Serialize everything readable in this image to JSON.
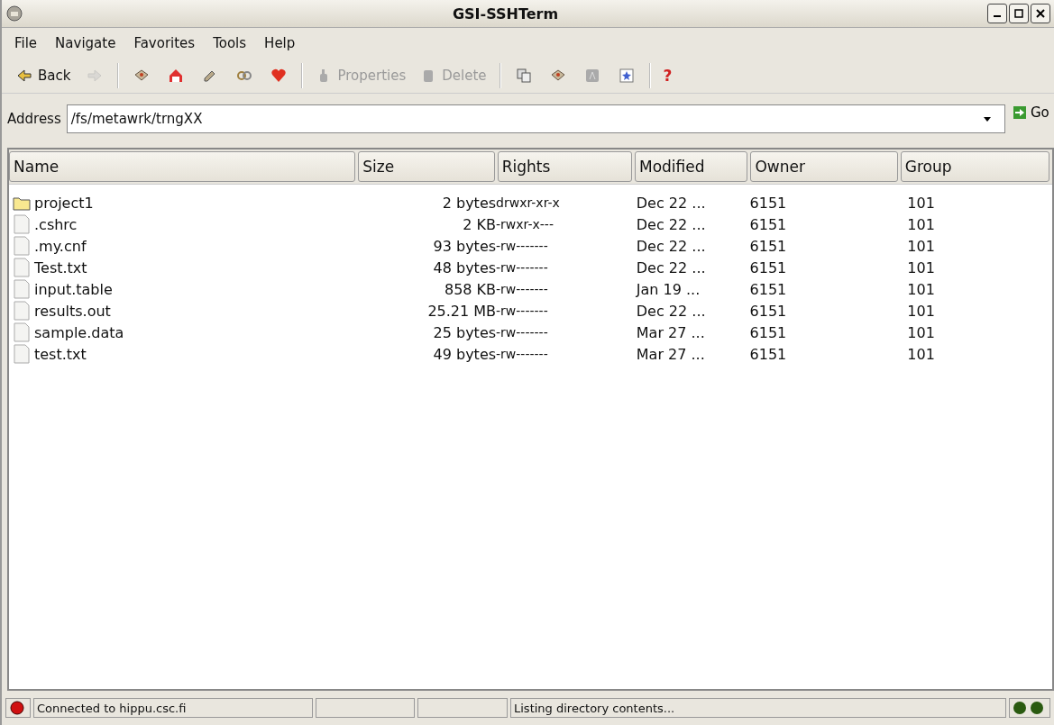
{
  "window": {
    "title": "GSI-SSHTerm"
  },
  "menu": [
    "File",
    "Navigate",
    "Favorites",
    "Tools",
    "Help"
  ],
  "toolbar": [
    {
      "kind": "text",
      "label": "Back",
      "disabled": false
    },
    {
      "kind": "icon",
      "disabled": true
    },
    {
      "kind": "separator"
    },
    {
      "kind": "icon",
      "disabled": false
    },
    {
      "kind": "icon",
      "disabled": false
    },
    {
      "kind": "icon",
      "disabled": false
    },
    {
      "kind": "icon",
      "disabled": false
    },
    {
      "kind": "icon",
      "disabled": false
    },
    {
      "kind": "separator"
    },
    {
      "kind": "text",
      "label": "Properties",
      "disabled": true
    },
    {
      "kind": "text",
      "label": "Delete",
      "disabled": true
    },
    {
      "kind": "separator"
    },
    {
      "kind": "icon",
      "disabled": false
    },
    {
      "kind": "icon",
      "disabled": false
    },
    {
      "kind": "icon",
      "disabled": false
    },
    {
      "kind": "icon",
      "disabled": false
    },
    {
      "kind": "separator"
    },
    {
      "kind": "help",
      "label": "?",
      "disabled": false
    }
  ],
  "address": {
    "label": "Address",
    "value": "/fs/metawrk/trngXX",
    "go": "Go"
  },
  "table": {
    "columns": [
      "Name",
      "Size",
      "Rights",
      "Modified",
      "Owner",
      "Group"
    ],
    "rows": [
      {
        "kind": "folder",
        "cells": [
          "project1",
          "2 bytes",
          "drwxr-xr-x",
          "Dec 22 ...",
          "6151",
          "101"
        ]
      },
      {
        "kind": "file",
        "cells": [
          ".cshrc",
          "2 KB",
          "-rwxr-x---",
          "Dec 22 ...",
          "6151",
          "101"
        ]
      },
      {
        "kind": "file",
        "cells": [
          ".my.cnf",
          "93 bytes",
          "-rw-------",
          "Dec 22 ...",
          "6151",
          "101"
        ]
      },
      {
        "kind": "file",
        "cells": [
          "Test.txt",
          "48 bytes",
          "-rw-------",
          "Dec 22 ...",
          "6151",
          "101"
        ]
      },
      {
        "kind": "file",
        "cells": [
          "input.table",
          "858 KB",
          "-rw-------",
          "Jan 19  ...",
          "6151",
          "101"
        ]
      },
      {
        "kind": "file",
        "cells": [
          "results.out",
          "25.21 MB",
          "-rw-------",
          "Dec 22 ...",
          "6151",
          "101"
        ]
      },
      {
        "kind": "file",
        "cells": [
          "sample.data",
          "25 bytes",
          "-rw-------",
          "Mar 27  ...",
          "6151",
          "101"
        ]
      },
      {
        "kind": "file",
        "cells": [
          "test.txt",
          "49 bytes",
          "-rw-------",
          "Mar 27  ...",
          "6151",
          "101"
        ]
      }
    ]
  },
  "status_bar": {
    "connected": false,
    "message": "Connected to hippu.csc.fi",
    "activity": "Listing directory contents..."
  }
}
